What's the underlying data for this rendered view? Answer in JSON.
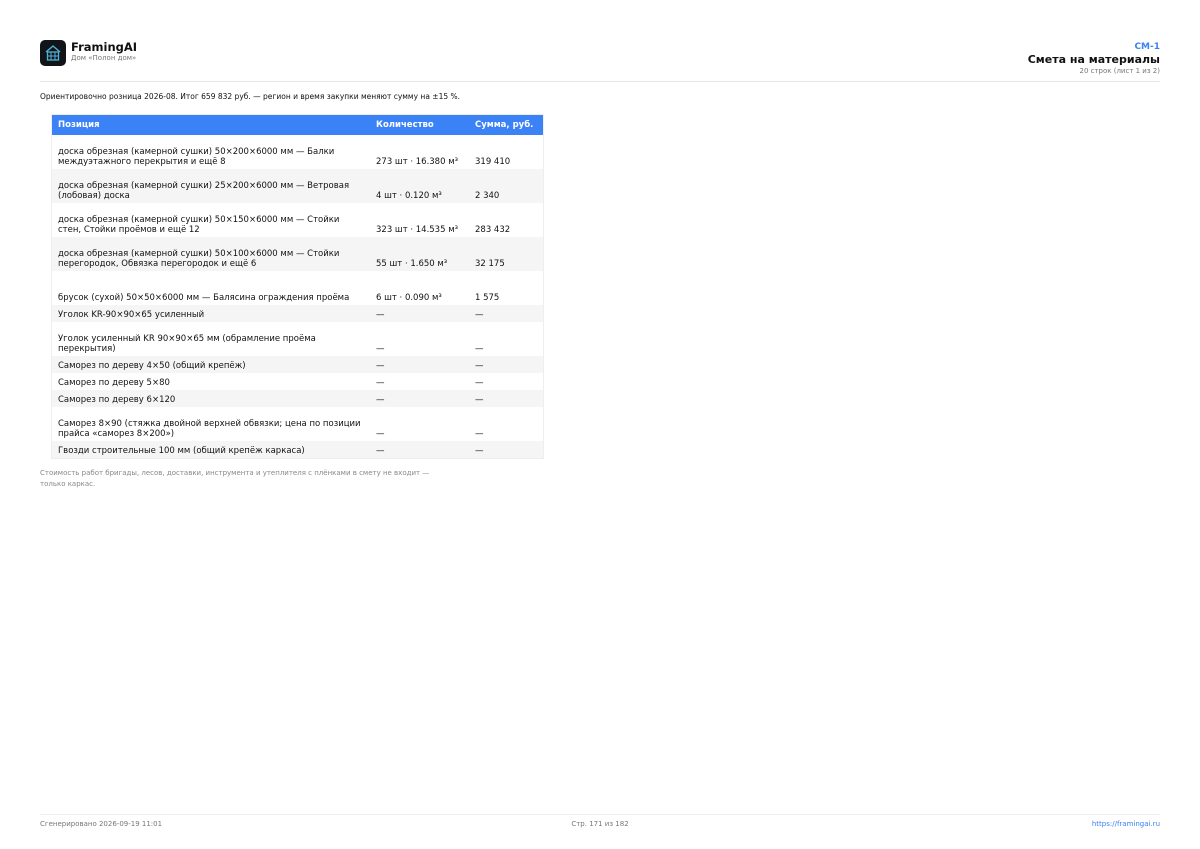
{
  "brand": {
    "name": "FramingAI",
    "project": "Дом «Полон дом»",
    "logo_icon": "house-icon"
  },
  "document": {
    "code": "СМ-1",
    "title": "Смета на материалы",
    "subtitle": "20 строк (лист 1 из 2)"
  },
  "intro": "Ориентировочно розница 2026-08. Итог 659 832 руб. — регион и время закупки меняют сумму на ±15 %.",
  "table": {
    "headers": {
      "position": "Позиция",
      "quantity": "Количество",
      "sum": "Сумма, руб."
    },
    "rows": [
      {
        "position": "доска обрезная (камерной сушки) 50×200×6000 мм — Балки междуэтажного перекрытия и ещё 8",
        "quantity": "273 шт · 16.380 м³",
        "sum": "319 410",
        "size": "tall"
      },
      {
        "position": "доска обрезная (камерной сушки) 25×200×6000 мм — Ветровая (лобовая) доска",
        "quantity": "4 шт · 0.120 м³",
        "sum": "2 340",
        "size": "tall"
      },
      {
        "position": "доска обрезная (камерной сушки) 50×150×6000 мм — Стойки стен, Стойки проёмов и ещё 12",
        "quantity": "323 шт · 14.535 м³",
        "sum": "283 432",
        "size": "tall"
      },
      {
        "position": "доска обрезная (камерной сушки) 50×100×6000 мм — Стойки перегородок, Обвязка перегородок и ещё 6",
        "quantity": "55 шт · 1.650 м³",
        "sum": "32 175",
        "size": "tall"
      },
      {
        "position": "брусок (сухой) 50×50×6000 мм — Балясина ограждения проёма",
        "quantity": "6 шт · 0.090 м³",
        "sum": "1 575",
        "size": "tall"
      },
      {
        "position": "Уголок KR-90×90×65 усиленный",
        "quantity": "—",
        "sum": "—",
        "size": "short"
      },
      {
        "position": "Уголок усиленный KR 90×90×65 мм (обрамление проёма перекрытия)",
        "quantity": "—",
        "sum": "—",
        "size": "tall"
      },
      {
        "position": "Саморез по дереву 4×50 (общий крепёж)",
        "quantity": "—",
        "sum": "—",
        "size": "short"
      },
      {
        "position": "Саморез по дереву 5×80",
        "quantity": "—",
        "sum": "—",
        "size": "short"
      },
      {
        "position": "Саморез по дереву 6×120",
        "quantity": "—",
        "sum": "—",
        "size": "short"
      },
      {
        "position": "Саморез 8×90 (стяжка двойной верхней обвязки; цена по позиции прайса «саморез 8×200»)",
        "quantity": "—",
        "sum": "—",
        "size": "tall"
      },
      {
        "position": "Гвозди строительные 100 мм (общий крепёж каркаса)",
        "quantity": "—",
        "sum": "—",
        "size": "short"
      }
    ]
  },
  "footnote": "Стоимость работ бригады, лесов, доставки, инструмента и утеплителя с плёнками в смету не входит — только каркас.",
  "footer": {
    "generated": "Сгенерировано 2026-09-19 11:01",
    "page": "Стр. 171 из 182",
    "url": "https://framingai.ru"
  },
  "colors": {
    "accent": "#3b82f6",
    "logo_bg": "#111418",
    "logo_line": "#4fb3d9"
  }
}
